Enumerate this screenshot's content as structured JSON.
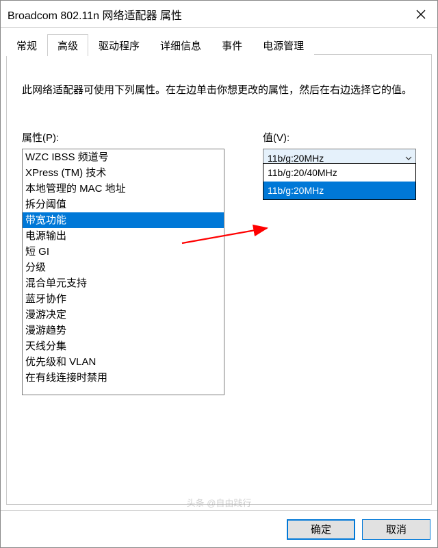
{
  "window": {
    "title": "Broadcom 802.11n 网络适配器 属性"
  },
  "tabs": {
    "items": [
      {
        "label": "常规"
      },
      {
        "label": "高级"
      },
      {
        "label": "驱动程序"
      },
      {
        "label": "详细信息"
      },
      {
        "label": "事件"
      },
      {
        "label": "电源管理"
      }
    ],
    "active_index": 1
  },
  "description": "此网络适配器可使用下列属性。在左边单击你想更改的属性，然后在右边选择它的值。",
  "properties": {
    "label": "属性(P):",
    "items": [
      "WZC IBSS 频道号",
      "XPress (TM) 技术",
      "本地管理的 MAC 地址",
      "拆分阈值",
      "带宽功能",
      "电源输出",
      "短 GI",
      "分级",
      "混合单元支持",
      "蓝牙协作",
      "漫游决定",
      "漫游趋势",
      "天线分集",
      "优先级和 VLAN",
      "在有线连接时禁用"
    ],
    "selected_index": 4
  },
  "value": {
    "label": "值(V):",
    "selected": "11b/g:20MHz",
    "options": [
      "11b/g:20/40MHz",
      "11b/g:20MHz"
    ],
    "highlight_index": 1
  },
  "buttons": {
    "ok": "确定",
    "cancel": "取消"
  },
  "watermark": "头条 @自由践行"
}
